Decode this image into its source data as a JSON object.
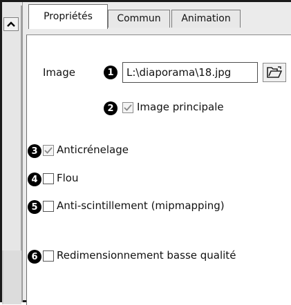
{
  "tabs": [
    {
      "label": "Propriétés",
      "active": true
    },
    {
      "label": "Commun",
      "active": false
    },
    {
      "label": "Animation",
      "active": false
    }
  ],
  "image": {
    "label": "Image",
    "path_value": "L:\\diaporama\\18.jpg",
    "browse_icon": "open-folder-icon"
  },
  "options": [
    {
      "number": "1",
      "target": "image-path-field"
    },
    {
      "number": "2",
      "label": "Image principale",
      "checked": true,
      "enabled": false
    },
    {
      "number": "3",
      "label": "Anticrénelage",
      "checked": true,
      "enabled": false
    },
    {
      "number": "4",
      "label": "Flou",
      "checked": false,
      "enabled": true
    },
    {
      "number": "5",
      "label": "Anti-scintillement (mipmapping)",
      "checked": false,
      "enabled": true
    },
    {
      "number": "6",
      "label": "Redimensionnement basse qualité",
      "checked": false,
      "enabled": true
    }
  ],
  "scrollbar": {
    "up_icon": "chevron-up-icon"
  }
}
